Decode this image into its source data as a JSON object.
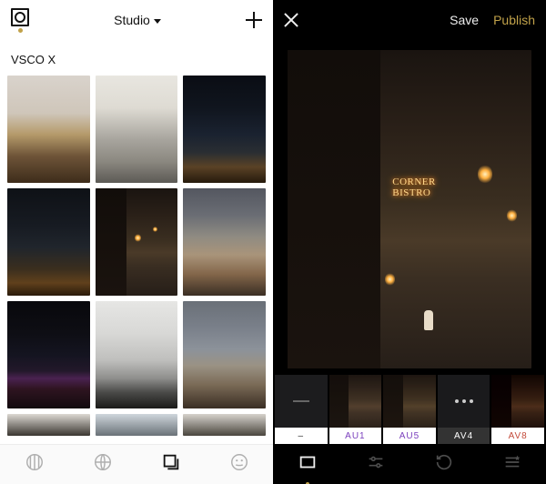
{
  "left": {
    "header": {
      "title": "Studio"
    },
    "section_label": "VSCO X",
    "tabs": [
      {
        "name": "feed-icon"
      },
      {
        "name": "explore-icon"
      },
      {
        "name": "studio-icon",
        "active": true
      },
      {
        "name": "profile-icon"
      }
    ]
  },
  "right": {
    "header": {
      "save": "Save",
      "publish": "Publish"
    },
    "neon_text": "CORNER\nBISTRO",
    "filters": [
      {
        "label": "–",
        "kind": "none"
      },
      {
        "label": "AU1",
        "kind": "au"
      },
      {
        "label": "AU5",
        "kind": "au"
      },
      {
        "label": "AV4",
        "kind": "active"
      },
      {
        "label": "AV8",
        "kind": "av8"
      }
    ],
    "tabs": [
      {
        "name": "presets-icon",
        "active": true
      },
      {
        "name": "adjust-icon"
      },
      {
        "name": "history-icon"
      },
      {
        "name": "favorites-icon"
      }
    ]
  }
}
